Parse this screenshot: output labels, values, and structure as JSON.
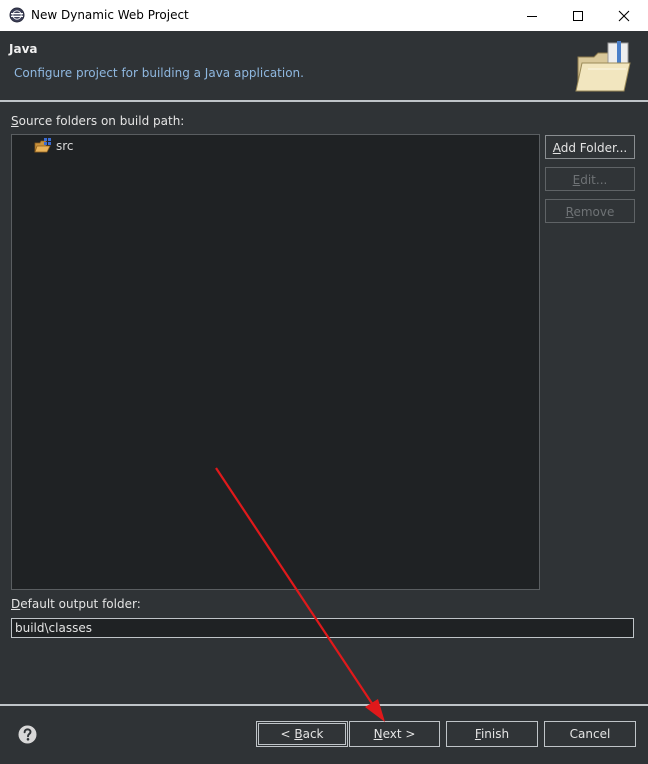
{
  "window": {
    "title": "New Dynamic Web Project",
    "controls": [
      "minimize",
      "maximize",
      "close"
    ]
  },
  "header": {
    "title": "Java",
    "description": "Configure project for building a Java application.",
    "banner_icon": "folder-wizard-icon"
  },
  "source_section": {
    "label": "Source folders on build path:",
    "label_mnemonic": "S",
    "label_rest": "ource folders on build path:",
    "items": [
      {
        "name": "src",
        "icon": "source-folder-icon"
      }
    ]
  },
  "side_buttons": {
    "add_folder": {
      "mn": "A",
      "rest": "dd Folder...",
      "enabled": true
    },
    "edit": {
      "mn": "E",
      "rest": "dit...",
      "enabled": false
    },
    "remove": {
      "mn": "R",
      "rest": "emove",
      "enabled": false
    }
  },
  "output": {
    "label_mn": "D",
    "label_rest": "efault output folder:",
    "value": "build\\classes"
  },
  "footer": {
    "help_icon": "help-icon",
    "back": {
      "pre": "< ",
      "mn": "B",
      "rest": "ack"
    },
    "next": {
      "mn": "N",
      "rest": "ext >"
    },
    "finish": {
      "mn": "F",
      "rest": "inish"
    },
    "cancel": "Cancel"
  },
  "annotation": {
    "type": "red-arrow",
    "color": "#e0191b"
  },
  "colors": {
    "background": "#2f3336",
    "panel": "#1f2224",
    "header_desc": "#8fb8e0",
    "border": "#bfc4c8"
  }
}
